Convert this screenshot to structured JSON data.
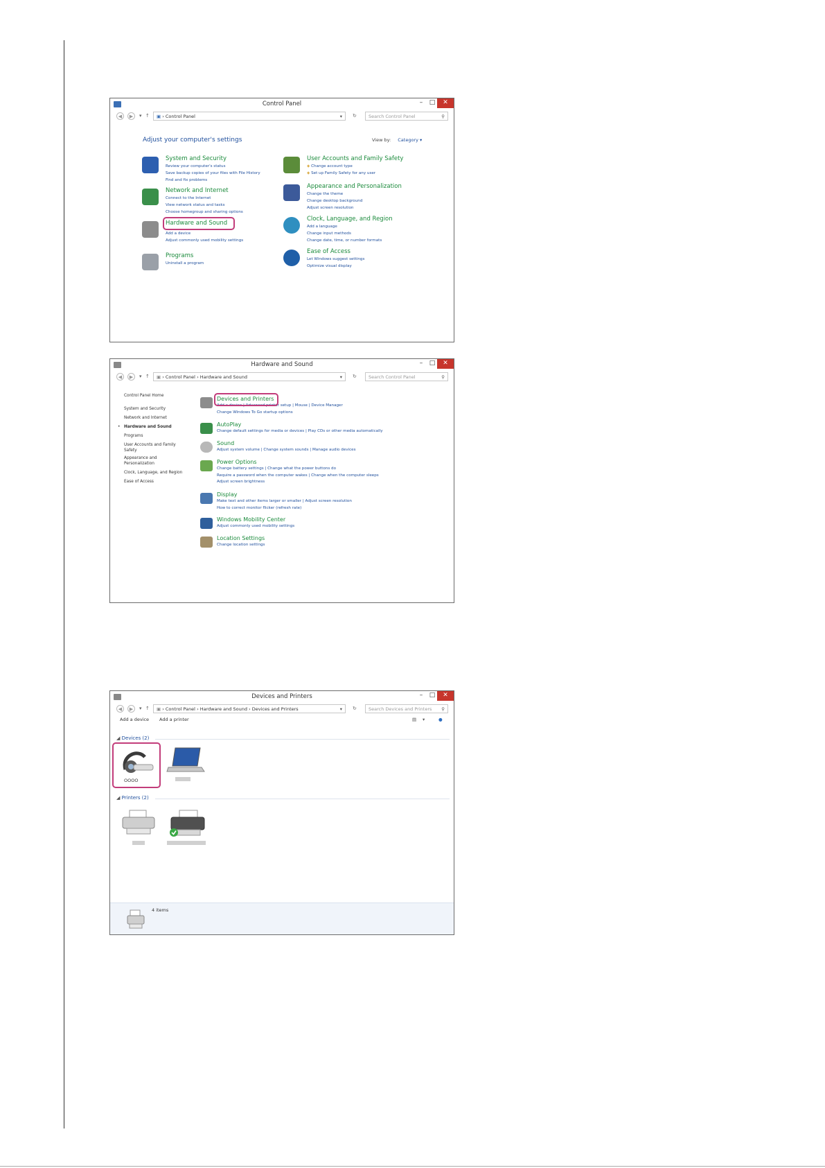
{
  "win1": {
    "title": "Control Panel",
    "address": "Control Panel",
    "search_placeholder": "Search Control Panel",
    "heading": "Adjust your computer's settings",
    "viewby_label": "View by:",
    "viewby_value": "Category",
    "categories": [
      {
        "title": "System and Security",
        "links": [
          "Review your computer's status",
          "Save backup copies of your files with File History",
          "Find and fix problems"
        ]
      },
      {
        "title": "Network and Internet",
        "links": [
          "Connect to the Internet",
          "View network status and tasks",
          "Choose homegroup and sharing options"
        ]
      },
      {
        "title": "Hardware and Sound",
        "links": [
          "Add a device",
          "Adjust commonly used mobility settings"
        ]
      },
      {
        "title": "Programs",
        "links": [
          "Uninstall a program"
        ]
      },
      {
        "title": "User Accounts and Family Safety",
        "links": [
          "Change account type",
          "Set up Family Safety for any user"
        ]
      },
      {
        "title": "Appearance and Personalization",
        "links": [
          "Change the theme",
          "Change desktop background",
          "Adjust screen resolution"
        ]
      },
      {
        "title": "Clock, Language, and Region",
        "links": [
          "Add a language",
          "Change input methods",
          "Change date, time, or number formats"
        ]
      },
      {
        "title": "Ease of Access",
        "links": [
          "Let Windows suggest settings",
          "Optimize visual display"
        ]
      }
    ]
  },
  "win2": {
    "title": "Hardware and Sound",
    "address_1": "Control Panel",
    "address_2": "Hardware and Sound",
    "search_placeholder": "Search Control Panel",
    "sidebar": [
      "Control Panel Home",
      "System and Security",
      "Network and Internet",
      "Hardware and Sound",
      "Programs",
      "User Accounts and Family Safety",
      "Appearance and Personalization",
      "Clock, Language, and Region",
      "Ease of Access"
    ],
    "tasks": [
      {
        "title": "Devices and Printers",
        "line1": "Add a device  |  Advanced printer setup  |  Mouse  |  Device Manager",
        "line2": "Change Windows To Go startup options"
      },
      {
        "title": "AutoPlay",
        "line1": "Change default settings for media or devices  |  Play CDs or other media automatically",
        "line2": ""
      },
      {
        "title": "Sound",
        "line1": "Adjust system volume  |  Change system sounds  |  Manage audio devices",
        "line2": ""
      },
      {
        "title": "Power Options",
        "line1": "Change battery settings  |  Change what the power buttons do",
        "line2": "Require a password when the computer wakes  |  Change when the computer sleeps",
        "line3": "Adjust screen brightness"
      },
      {
        "title": "Display",
        "line1": "Make text and other items larger or smaller  |  Adjust screen resolution",
        "line2": "How to correct monitor flicker (refresh rate)"
      },
      {
        "title": "Windows Mobility Center",
        "line1": "Adjust commonly used mobility settings",
        "line2": ""
      },
      {
        "title": "Location Settings",
        "line1": "Change location settings",
        "line2": ""
      }
    ]
  },
  "win3": {
    "title": "Devices and Printers",
    "address_1": "Control Panel",
    "address_2": "Hardware and Sound",
    "address_3": "Devices and Printers",
    "search_placeholder": "Search Devices and Printers",
    "cmd_add_device": "Add a device",
    "cmd_add_printer": "Add a printer",
    "group_devices": "Devices (2)",
    "group_printers": "Printers (2)",
    "headset_label": "OOOO",
    "status_count": "4 items"
  },
  "colors": {
    "highlight": "#c23c7a",
    "link": "#1e4e9c",
    "green_title": "#1a8a3b",
    "close": "#c7352c"
  }
}
